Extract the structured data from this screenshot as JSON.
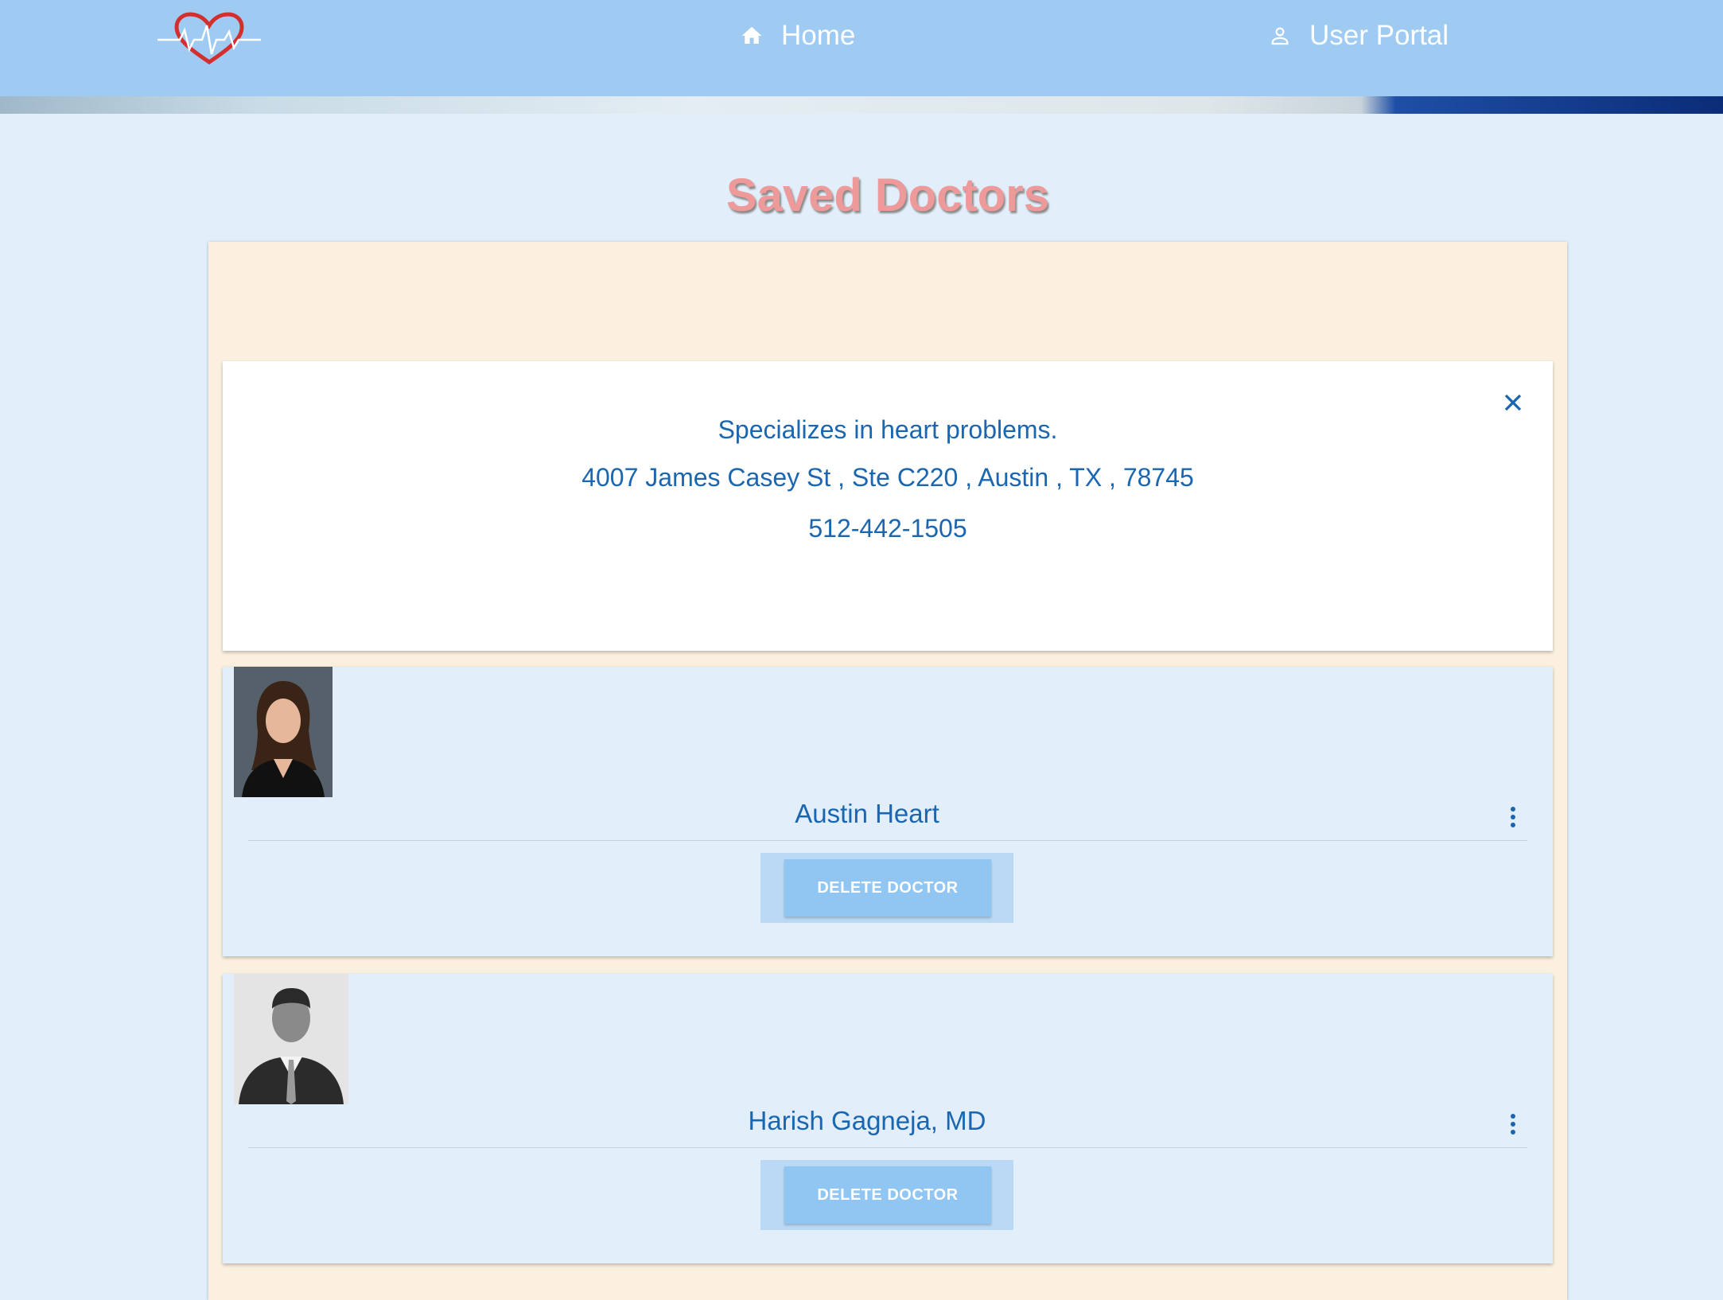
{
  "nav": {
    "logo_icon": "heart-pulse-logo",
    "home_label": "Home",
    "home_icon": "home-icon",
    "portal_label": "User Portal",
    "portal_icon": "person-icon"
  },
  "page": {
    "title": "Saved Doctors"
  },
  "detail": {
    "specialty": "Specializes in heart problems.",
    "address": "4007 James Casey St , Ste C220 , Austin , TX , 78745",
    "phone": "512-442-1505",
    "close_icon": "close-icon"
  },
  "doctors": [
    {
      "name": "Austin Heart",
      "delete_label": "DELETE DOCTOR",
      "menu_icon": "more-vert-icon"
    },
    {
      "name": "Harish Gagneja, MD",
      "delete_label": "DELETE DOCTOR",
      "menu_icon": "more-vert-icon"
    }
  ],
  "colors": {
    "nav_bg": "#9fcbf2",
    "page_bg": "#e2effb",
    "panel_bg": "#fbf0df",
    "text_blue": "#1a66b0",
    "title_pink": "#ef9a9a",
    "button_bg": "#91c6f3"
  }
}
